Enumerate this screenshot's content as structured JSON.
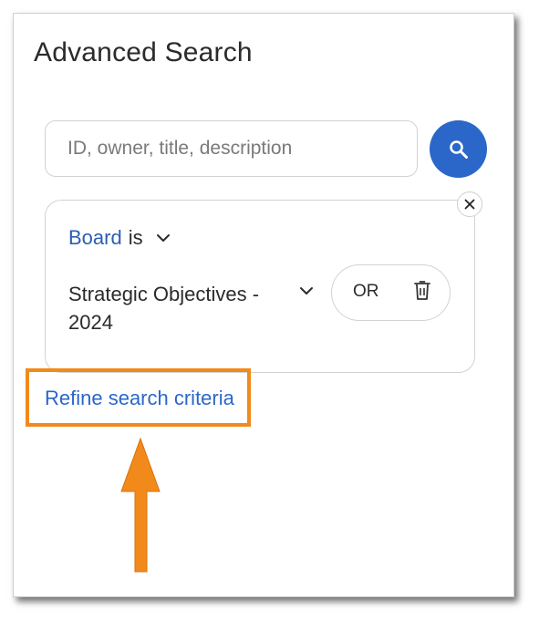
{
  "dialog": {
    "title": "Advanced Search"
  },
  "search": {
    "placeholder": "ID, owner, title, description",
    "value": "",
    "button_icon": "search-icon"
  },
  "criteria": {
    "field": "Board",
    "operator": "is",
    "value": "Strategic Objectives - 2024",
    "logic": "OR",
    "remove_icon": "close-icon",
    "delete_icon": "trash-icon"
  },
  "refine": {
    "label": "Refine search criteria"
  },
  "annotation": {
    "highlight_color": "#f28a1b",
    "arrow_icon": "arrow-up-icon"
  },
  "colors": {
    "accent": "#2a67c9",
    "link": "#2a5fb0",
    "text": "#2b2b2b"
  }
}
